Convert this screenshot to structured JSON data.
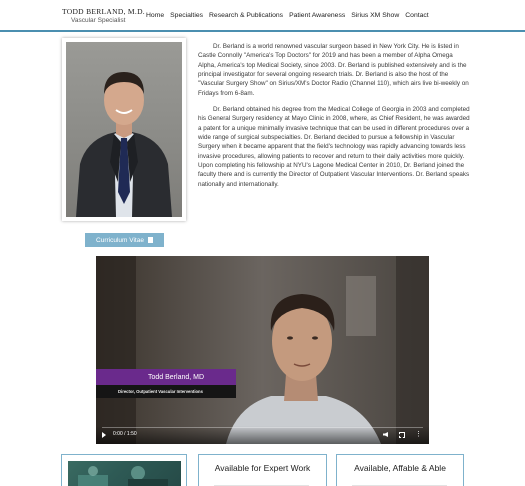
{
  "header": {
    "logo_name": "TODD BERLAND, M.D.",
    "logo_subtitle": "Vascular Specialist",
    "nav": [
      "Home",
      "Specialties",
      "Research & Publications",
      "Patient Awareness",
      "Sirius XM Show",
      "Contact"
    ]
  },
  "bio": {
    "paragraph1": "Dr. Berland is a world renowned vascular surgeon based in New York City. He is listed in Castle Connolly \"America's Top Doctors\" for 2019 and has been a member of Alpha Omega Alpha, America's top Medical Society, since 2003. Dr. Berland is published extensively and is the principal investigator for several ongoing research trials. Dr. Berland is also the host of the \"Vascular Surgery Show\" on Sirius/XM's Doctor Radio (Channel 110), which airs live bi-weekly on Fridays from 6-8am.",
    "paragraph2": "Dr. Berland obtained his degree from the Medical College of Georgia in 2003 and completed his General Surgery residency at Mayo Clinic in 2008, where, as Chief Resident, he was awarded a patent for a unique minimally invasive technique that can be used in different procedures over a wide range of surgical subspecialties. Dr. Berland decided to pursue a fellowship in Vascular Surgery when it became apparent that the field's technology was rapidly advancing towards less invasive procedures, allowing patients to recover and return to their daily activities more quickly. Upon completing his fellowship at NYU's Lagone Medical Center in 2010, Dr. Berland joined the faculty there and is currently the Director of Outpatient Vascular Interventions. Dr. Berland speaks nationally and internationally."
  },
  "cv_button": {
    "label": "Curriculum Vitae",
    "icon": "document-icon"
  },
  "video": {
    "lower_third_name": "Todd Berland, MD",
    "lower_third_title": "Director, Outpatient Vascular Interventions",
    "time": "0:00 / 1:50",
    "progress": 0,
    "name_bar_color": "#6a2a8c"
  },
  "cards": [
    {
      "title": ""
    },
    {
      "title": "Available for Expert Work"
    },
    {
      "title": "Available, Affable & Able"
    }
  ],
  "colors": {
    "accent": "#7fb2cc",
    "header_border": "#4b8fb0"
  }
}
